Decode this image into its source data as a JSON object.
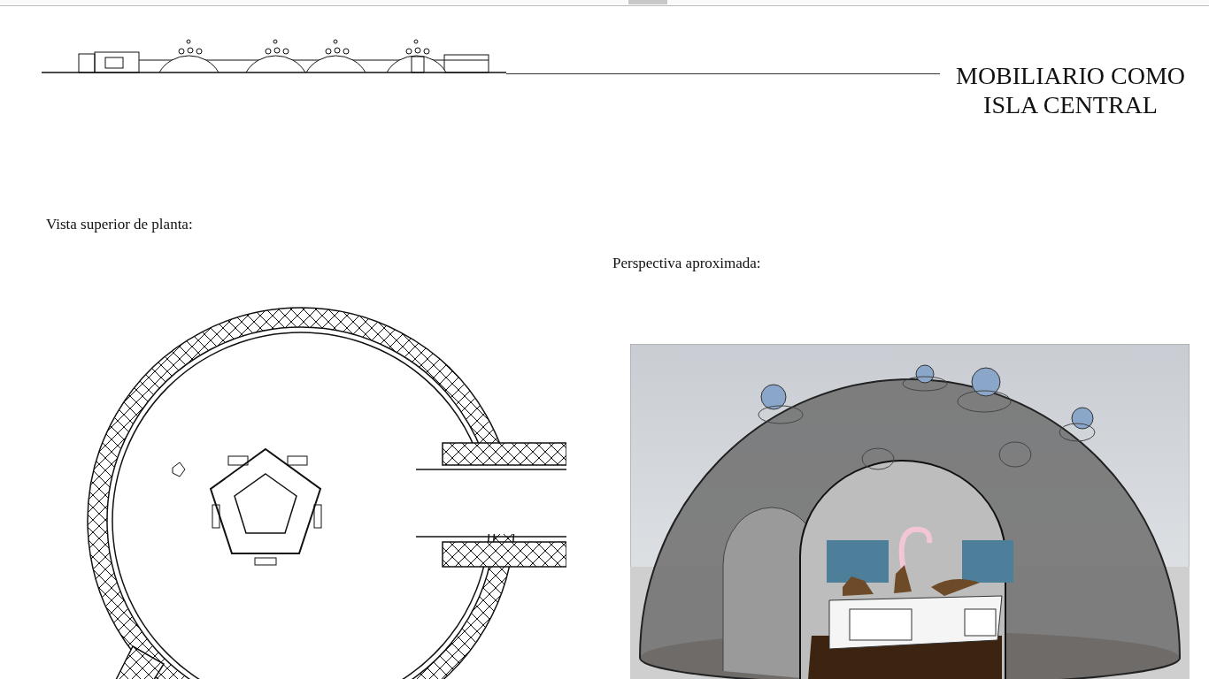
{
  "title_lines": [
    "MOBILIARIO COMO",
    "ISLA CENTRAL"
  ],
  "panels": [
    {
      "kind": "plan",
      "label": "Vista superior de planta:"
    },
    {
      "kind": "render",
      "label": "Perspectiva aproximada:"
    }
  ]
}
